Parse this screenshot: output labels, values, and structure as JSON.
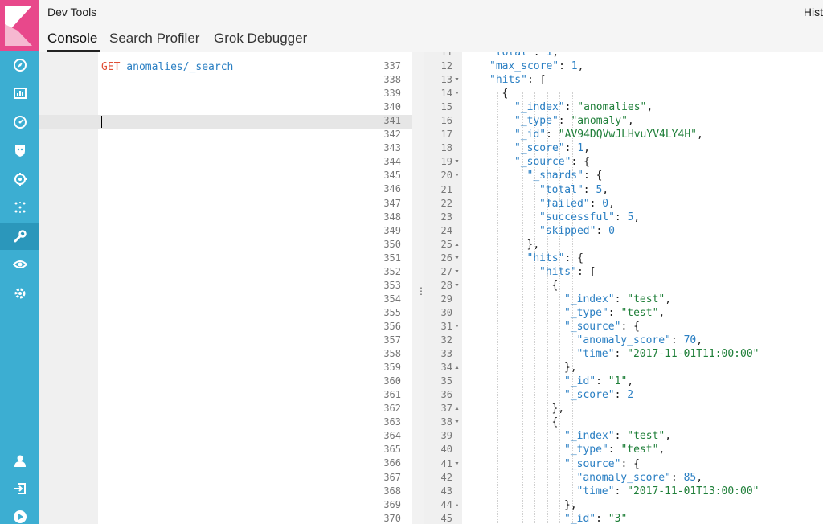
{
  "header": {
    "app_title": "Dev Tools",
    "history_label": "Hist",
    "tabs": [
      {
        "label": "Console"
      },
      {
        "label": "Search Profiler"
      },
      {
        "label": "Grok Debugger"
      }
    ]
  },
  "sidebar": {
    "icons": [
      "compass-icon",
      "bar-chart-icon",
      "gauge-icon",
      "shield-icon",
      "cluster-icon",
      "ml-icon",
      "wrench-icon",
      "eye-icon",
      "gear-icon",
      "user-icon",
      "logout-icon",
      "play-icon"
    ],
    "active": "wrench-icon"
  },
  "request": {
    "method": "GET",
    "path": " anomalies/_search",
    "line_numbers": [
      "337",
      "338",
      "339",
      "340",
      "341",
      "342",
      "343",
      "344",
      "345",
      "346",
      "347",
      "348",
      "349",
      "350",
      "351",
      "352",
      "353",
      "354",
      "355",
      "356",
      "357",
      "358",
      "359",
      "360",
      "361",
      "362",
      "363",
      "364",
      "365",
      "366",
      "367",
      "368",
      "369",
      "370"
    ]
  },
  "response": {
    "lines": [
      {
        "num": "11",
        "indent": 2,
        "parts": [
          [
            "k",
            "\"total\""
          ],
          [
            "p",
            ": "
          ],
          [
            "n",
            "1"
          ],
          [
            "p",
            ","
          ]
        ]
      },
      {
        "num": "12",
        "indent": 2,
        "parts": [
          [
            "k",
            "\"max_score\""
          ],
          [
            "p",
            ": "
          ],
          [
            "n",
            "1"
          ],
          [
            "p",
            ","
          ]
        ]
      },
      {
        "num": "13",
        "fold": "down",
        "indent": 2,
        "parts": [
          [
            "k",
            "\"hits\""
          ],
          [
            "p",
            ": ["
          ]
        ]
      },
      {
        "num": "14",
        "fold": "down",
        "indent": 3,
        "parts": [
          [
            "p",
            "{"
          ]
        ]
      },
      {
        "num": "15",
        "indent": 4,
        "parts": [
          [
            "k",
            "\"_index\""
          ],
          [
            "p",
            ": "
          ],
          [
            "s",
            "\"anomalies\""
          ],
          [
            "p",
            ","
          ]
        ]
      },
      {
        "num": "16",
        "indent": 4,
        "parts": [
          [
            "k",
            "\"_type\""
          ],
          [
            "p",
            ": "
          ],
          [
            "s",
            "\"anomaly\""
          ],
          [
            "p",
            ","
          ]
        ]
      },
      {
        "num": "17",
        "indent": 4,
        "parts": [
          [
            "k",
            "\"_id\""
          ],
          [
            "p",
            ": "
          ],
          [
            "s",
            "\"AV94DQVwJLHvuYV4LY4H\""
          ],
          [
            "p",
            ","
          ]
        ]
      },
      {
        "num": "18",
        "indent": 4,
        "parts": [
          [
            "k",
            "\"_score\""
          ],
          [
            "p",
            ": "
          ],
          [
            "n",
            "1"
          ],
          [
            "p",
            ","
          ]
        ]
      },
      {
        "num": "19",
        "fold": "down",
        "indent": 4,
        "parts": [
          [
            "k",
            "\"_source\""
          ],
          [
            "p",
            ": {"
          ]
        ]
      },
      {
        "num": "20",
        "fold": "down",
        "indent": 5,
        "parts": [
          [
            "k",
            "\"_shards\""
          ],
          [
            "p",
            ": {"
          ]
        ]
      },
      {
        "num": "21",
        "indent": 6,
        "parts": [
          [
            "k",
            "\"total\""
          ],
          [
            "p",
            ": "
          ],
          [
            "n",
            "5"
          ],
          [
            "p",
            ","
          ]
        ]
      },
      {
        "num": "22",
        "indent": 6,
        "parts": [
          [
            "k",
            "\"failed\""
          ],
          [
            "p",
            ": "
          ],
          [
            "n",
            "0"
          ],
          [
            "p",
            ","
          ]
        ]
      },
      {
        "num": "23",
        "indent": 6,
        "parts": [
          [
            "k",
            "\"successful\""
          ],
          [
            "p",
            ": "
          ],
          [
            "n",
            "5"
          ],
          [
            "p",
            ","
          ]
        ]
      },
      {
        "num": "24",
        "indent": 6,
        "parts": [
          [
            "k",
            "\"skipped\""
          ],
          [
            "p",
            ": "
          ],
          [
            "n",
            "0"
          ]
        ]
      },
      {
        "num": "25",
        "fold": "up",
        "indent": 5,
        "parts": [
          [
            "p",
            "},"
          ]
        ]
      },
      {
        "num": "26",
        "fold": "down",
        "indent": 5,
        "parts": [
          [
            "k",
            "\"hits\""
          ],
          [
            "p",
            ": {"
          ]
        ]
      },
      {
        "num": "27",
        "fold": "down",
        "indent": 6,
        "parts": [
          [
            "k",
            "\"hits\""
          ],
          [
            "p",
            ": ["
          ]
        ]
      },
      {
        "num": "28",
        "fold": "down",
        "indent": 7,
        "parts": [
          [
            "p",
            "{"
          ]
        ]
      },
      {
        "num": "29",
        "indent": 8,
        "parts": [
          [
            "k",
            "\"_index\""
          ],
          [
            "p",
            ": "
          ],
          [
            "s",
            "\"test\""
          ],
          [
            "p",
            ","
          ]
        ]
      },
      {
        "num": "30",
        "indent": 8,
        "parts": [
          [
            "k",
            "\"_type\""
          ],
          [
            "p",
            ": "
          ],
          [
            "s",
            "\"test\""
          ],
          [
            "p",
            ","
          ]
        ]
      },
      {
        "num": "31",
        "fold": "down",
        "indent": 8,
        "parts": [
          [
            "k",
            "\"_source\""
          ],
          [
            "p",
            ": {"
          ]
        ]
      },
      {
        "num": "32",
        "indent": 9,
        "parts": [
          [
            "k",
            "\"anomaly_score\""
          ],
          [
            "p",
            ": "
          ],
          [
            "n",
            "70"
          ],
          [
            "p",
            ","
          ]
        ]
      },
      {
        "num": "33",
        "indent": 9,
        "parts": [
          [
            "k",
            "\"time\""
          ],
          [
            "p",
            ": "
          ],
          [
            "s",
            "\"2017-11-01T11:00:00\""
          ]
        ]
      },
      {
        "num": "34",
        "fold": "up",
        "indent": 8,
        "parts": [
          [
            "p",
            "},"
          ]
        ]
      },
      {
        "num": "35",
        "indent": 8,
        "parts": [
          [
            "k",
            "\"_id\""
          ],
          [
            "p",
            ": "
          ],
          [
            "s",
            "\"1\""
          ],
          [
            "p",
            ","
          ]
        ]
      },
      {
        "num": "36",
        "indent": 8,
        "parts": [
          [
            "k",
            "\"_score\""
          ],
          [
            "p",
            ": "
          ],
          [
            "n",
            "2"
          ]
        ]
      },
      {
        "num": "37",
        "fold": "up",
        "indent": 7,
        "parts": [
          [
            "p",
            "},"
          ]
        ]
      },
      {
        "num": "38",
        "fold": "down",
        "indent": 7,
        "parts": [
          [
            "p",
            "{"
          ]
        ]
      },
      {
        "num": "39",
        "indent": 8,
        "parts": [
          [
            "k",
            "\"_index\""
          ],
          [
            "p",
            ": "
          ],
          [
            "s",
            "\"test\""
          ],
          [
            "p",
            ","
          ]
        ]
      },
      {
        "num": "40",
        "indent": 8,
        "parts": [
          [
            "k",
            "\"_type\""
          ],
          [
            "p",
            ": "
          ],
          [
            "s",
            "\"test\""
          ],
          [
            "p",
            ","
          ]
        ]
      },
      {
        "num": "41",
        "fold": "down",
        "indent": 8,
        "parts": [
          [
            "k",
            "\"_source\""
          ],
          [
            "p",
            ": {"
          ]
        ]
      },
      {
        "num": "42",
        "indent": 9,
        "parts": [
          [
            "k",
            "\"anomaly_score\""
          ],
          [
            "p",
            ": "
          ],
          [
            "n",
            "85"
          ],
          [
            "p",
            ","
          ]
        ]
      },
      {
        "num": "43",
        "indent": 9,
        "parts": [
          [
            "k",
            "\"time\""
          ],
          [
            "p",
            ": "
          ],
          [
            "s",
            "\"2017-11-01T13:00:00\""
          ]
        ]
      },
      {
        "num": "44",
        "fold": "up",
        "indent": 8,
        "parts": [
          [
            "p",
            "},"
          ]
        ]
      },
      {
        "num": "45",
        "indent": 8,
        "parts": [
          [
            "k",
            "\"_id\""
          ],
          [
            "p",
            ": "
          ],
          [
            "s",
            "\"3\""
          ]
        ]
      }
    ]
  }
}
